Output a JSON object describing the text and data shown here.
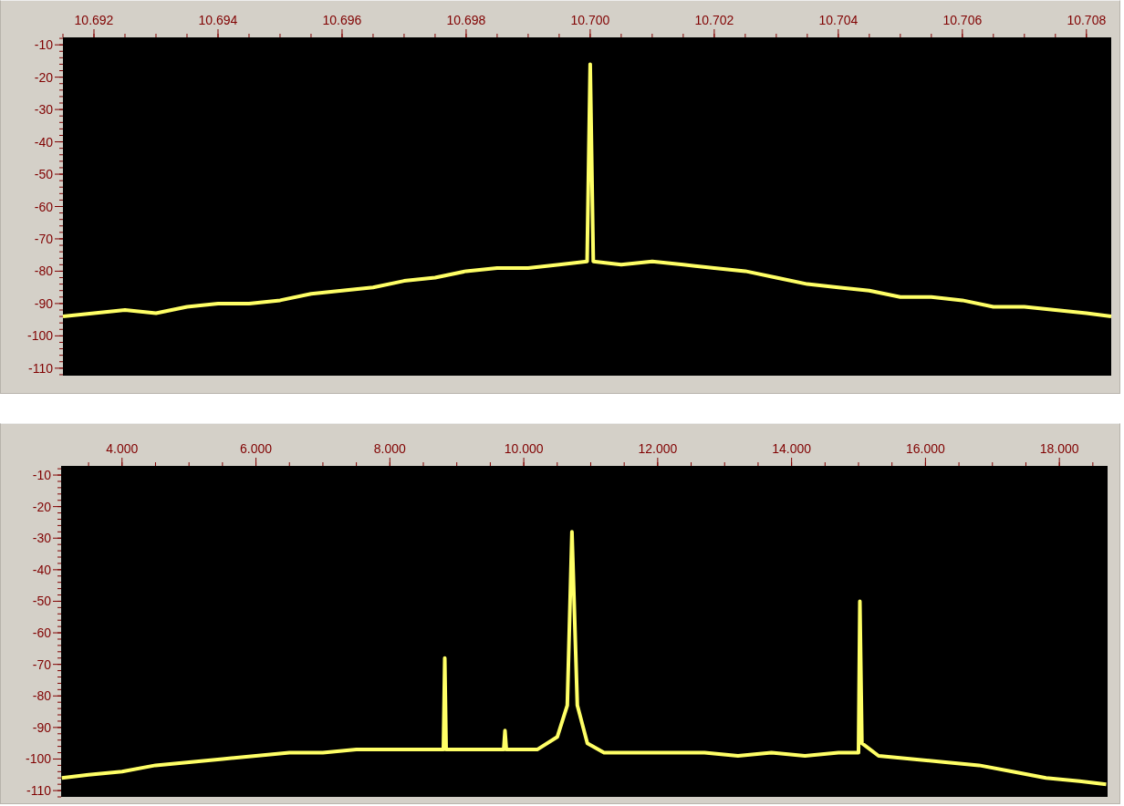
{
  "charts": [
    {
      "chart_data": {
        "type": "line",
        "xlim": [
          10691.5,
          10708.4
        ],
        "ylim": [
          -112.3,
          -7.7
        ],
        "xticks": [
          {
            "value": 10692,
            "label": "10.692"
          },
          {
            "value": 10694,
            "label": "10.694"
          },
          {
            "value": 10696,
            "label": "10.696"
          },
          {
            "value": 10698,
            "label": "10.698"
          },
          {
            "value": 10700,
            "label": "10.700"
          },
          {
            "value": 10702,
            "label": "10.702"
          },
          {
            "value": 10704,
            "label": "10.704"
          },
          {
            "value": 10706,
            "label": "10.706"
          },
          {
            "value": 10708,
            "label": "10.708"
          }
        ],
        "yticks": [
          -10,
          -20,
          -30,
          -40,
          -50,
          -60,
          -70,
          -80,
          -90,
          -100,
          -110
        ],
        "x": [
          10691.5,
          10692,
          10692.5,
          10693,
          10693.5,
          10694,
          10694.5,
          10695,
          10695.5,
          10696,
          10696.5,
          10697,
          10697.5,
          10698,
          10698.5,
          10699,
          10699.5,
          10699.95,
          10700,
          10700.05,
          10700.5,
          10701,
          10701.5,
          10702,
          10702.5,
          10703,
          10703.5,
          10704,
          10704.5,
          10705,
          10705.5,
          10706,
          10706.5,
          10707,
          10707.5,
          10708,
          10708.4
        ],
        "series": [
          {
            "color": "#ffff66",
            "values": [
              -94,
              -93,
              -92,
              -93,
              -91,
              -90,
              -90,
              -89,
              -87,
              -86,
              -85,
              -83,
              -82,
              -80,
              -79,
              -79,
              -78,
              -77,
              -16,
              -77,
              -78,
              -77,
              -78,
              -79,
              -80,
              -82,
              -84,
              -85,
              -86,
              -88,
              -88,
              -89,
              -91,
              -91,
              -92,
              -93,
              -94
            ]
          }
        ]
      }
    },
    {
      "chart_data": {
        "type": "line",
        "xlim": [
          3090,
          18720
        ],
        "ylim": [
          -112,
          -7.1
        ],
        "xticks": [
          {
            "value": 4000,
            "label": "4.000"
          },
          {
            "value": 6000,
            "label": "6.000"
          },
          {
            "value": 8000,
            "label": "8.000"
          },
          {
            "value": 10000,
            "label": "10.000"
          },
          {
            "value": 12000,
            "label": "12.000"
          },
          {
            "value": 14000,
            "label": "14.000"
          },
          {
            "value": 16000,
            "label": "16.000"
          },
          {
            "value": 18000,
            "label": "18.000"
          }
        ],
        "yticks": [
          -10,
          -20,
          -30,
          -40,
          -50,
          -60,
          -70,
          -80,
          -90,
          -100,
          -110
        ],
        "x": [
          3100,
          3500,
          4000,
          4500,
          5000,
          5500,
          6000,
          6500,
          7000,
          7500,
          8000,
          8500,
          8800,
          8820,
          8840,
          9200,
          9700,
          9720,
          9740,
          10200,
          10500,
          10650,
          10720,
          10800,
          10950,
          11200,
          11700,
          12200,
          12700,
          13200,
          13700,
          14200,
          14700,
          15000,
          15020,
          15050,
          15300,
          15800,
          16300,
          16800,
          17300,
          17800,
          18300,
          18700
        ],
        "series": [
          {
            "color": "#ffff66",
            "values": [
              -106,
              -105,
              -104,
              -102,
              -101,
              -100,
              -99,
              -98,
              -98,
              -97,
              -97,
              -97,
              -97,
              -68,
              -97,
              -97,
              -97,
              -91,
              -97,
              -97,
              -93,
              -83,
              -28,
              -83,
              -95,
              -98,
              -98,
              -98,
              -98,
              -99,
              -98,
              -99,
              -98,
              -98,
              -50,
              -95,
              -99,
              -100,
              -101,
              -102,
              -104,
              -106,
              -107,
              -108
            ]
          }
        ]
      }
    }
  ]
}
